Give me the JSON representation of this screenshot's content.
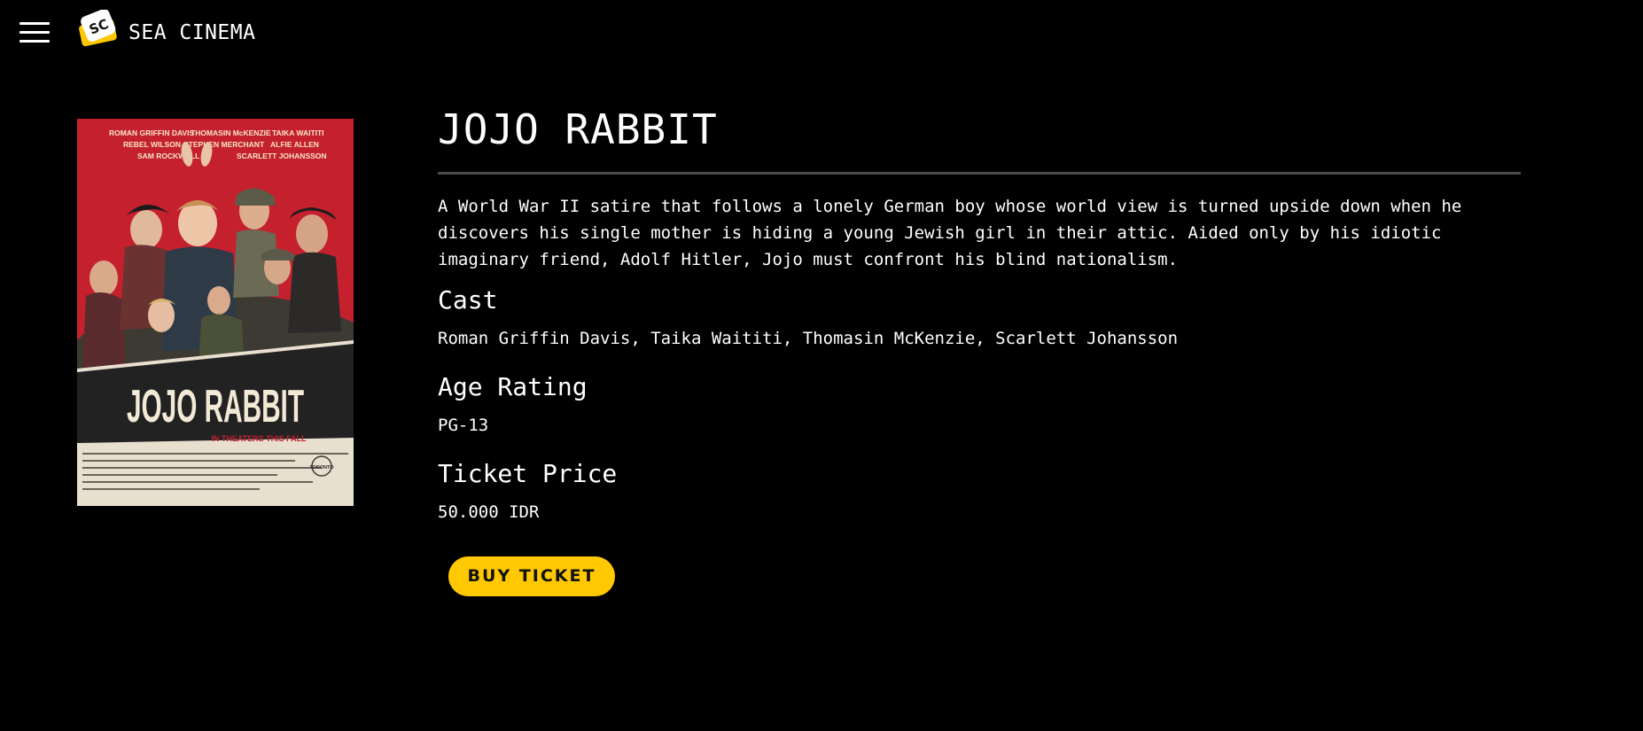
{
  "header": {
    "brand": "SEA CINEMA",
    "logo_text": "SC",
    "menu_icon": "hamburger-menu-icon"
  },
  "colors": {
    "background": "#000000",
    "accent": "#ffc800",
    "divider": "#4a4a4a",
    "poster_red": "#c4202e"
  },
  "poster": {
    "title": "JOJO RABBIT",
    "tagline": "IN THEATERS THIS FALL",
    "credits": [
      "ROMAN GRIFFIN DAVIS",
      "THOMASIN McKENZIE",
      "TAIKA WAITITI",
      "REBEL WILSON",
      "STEPHEN MERCHANT",
      "ALFIE ALLEN",
      "SAM ROCKWELL",
      "SCARLETT JOHANSSON"
    ],
    "festival": "TORONTO"
  },
  "movie": {
    "title": "JOJO RABBIT",
    "synopsis": "A World War II satire that follows a lonely German boy whose world view is turned upside down when he discovers his single mother is hiding a young Jewish girl in their attic. Aided only by his idiotic imaginary friend, Adolf Hitler, Jojo must confront his blind nationalism.",
    "cast_heading": "Cast",
    "cast": "Roman Griffin Davis, Taika Waititi, Thomasin McKenzie, Scarlett Johansson",
    "age_heading": "Age Rating",
    "age_rating": "PG-13",
    "price_heading": "Ticket Price",
    "price": "50.000 IDR"
  },
  "actions": {
    "buy_label": "BUY TICKET"
  }
}
